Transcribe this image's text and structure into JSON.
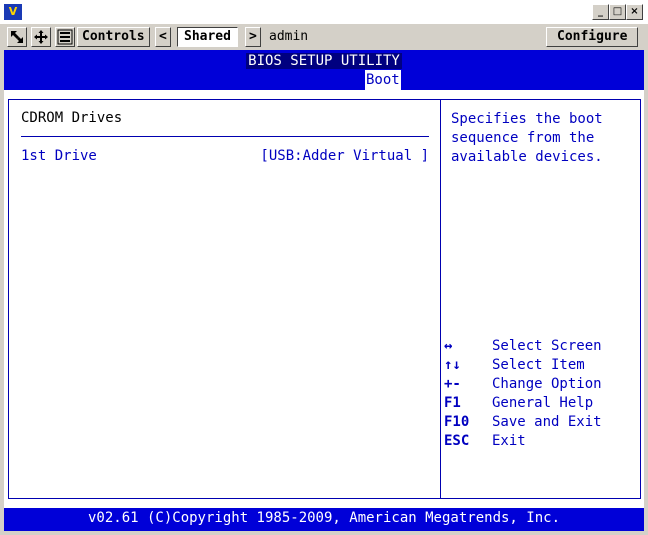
{
  "window": {
    "logo": "V",
    "controls": [
      "_",
      "□",
      "×"
    ]
  },
  "toolbar": {
    "controls_label": "Controls",
    "prev_label": "<",
    "shared_label": "Shared",
    "next_label": ">",
    "user": "admin",
    "configure_label": "Configure"
  },
  "bios": {
    "header": "BIOS SETUP UTILITY",
    "active_tab": "Boot",
    "section_title": "CDROM Drives",
    "options": [
      {
        "label": "1st Drive",
        "value": "[USB:Adder Virtual ]"
      }
    ],
    "help": "Specifies the boot\nsequence from the\navailable devices.",
    "keys": [
      {
        "key": "↔",
        "desc": "Select Screen"
      },
      {
        "key": "↑↓",
        "desc": "Select Item"
      },
      {
        "key": "+-",
        "desc": "Change Option"
      },
      {
        "key": "F1",
        "desc": "General Help"
      },
      {
        "key": "F10",
        "desc": "Save and Exit"
      },
      {
        "key": "ESC",
        "desc": "Exit"
      }
    ],
    "footer": "v02.61 (C)Copyright 1985-2009, American Megatrends, Inc."
  },
  "colors": {
    "bios_blue": "#0000d8",
    "text_blue": "#0000c0"
  }
}
